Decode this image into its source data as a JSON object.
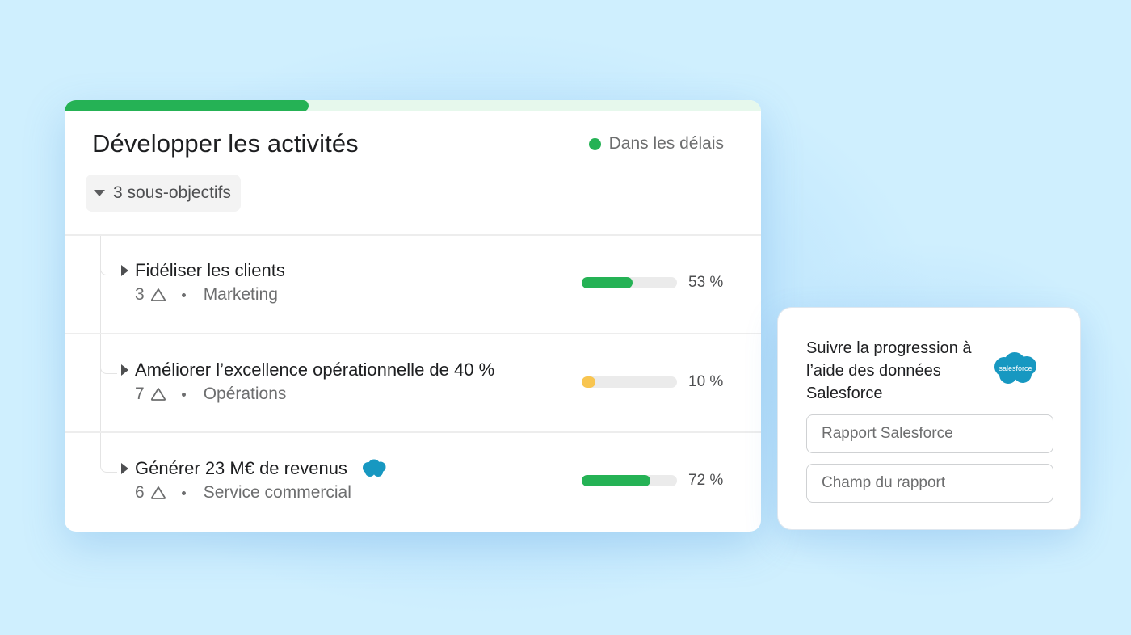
{
  "goal": {
    "title": "Développer les activités",
    "status_label": "Dans les délais",
    "status_color": "#25b255",
    "progress_fraction": 0.35,
    "subgoals_toggle_label": "3 sous-objectifs"
  },
  "subgoals": [
    {
      "title": "Fidéliser les clients",
      "count": "3",
      "team": "Marketing",
      "progress": 53,
      "progress_label": "53 %",
      "bar_color": "#25b255",
      "has_salesforce_icon": false
    },
    {
      "title": "Améliorer l’excellence opérationnelle de 40 %",
      "count": "7",
      "team": "Opérations",
      "progress": 10,
      "progress_label": "10 %",
      "bar_color": "#f8c550",
      "has_salesforce_icon": false
    },
    {
      "title": "Générer 23 M€ de revenus",
      "count": "6",
      "team": "Service commercial",
      "progress": 72,
      "progress_label": "72 %",
      "bar_color": "#25b255",
      "has_salesforce_icon": true
    }
  ],
  "salesforce_panel": {
    "text": "Suivre la progression à l’aide des données Salesforce",
    "logo_text": "salesforce",
    "logo_color": "#1798c1",
    "report_placeholder": "Rapport Salesforce",
    "field_placeholder": "Champ du rapport"
  },
  "icons": {
    "status": "status-dot-icon",
    "toggle": "caret-down-icon",
    "expand": "caret-right-icon",
    "collaborators": "triangle-outline-icon",
    "salesforce": "salesforce-cloud-icon"
  }
}
